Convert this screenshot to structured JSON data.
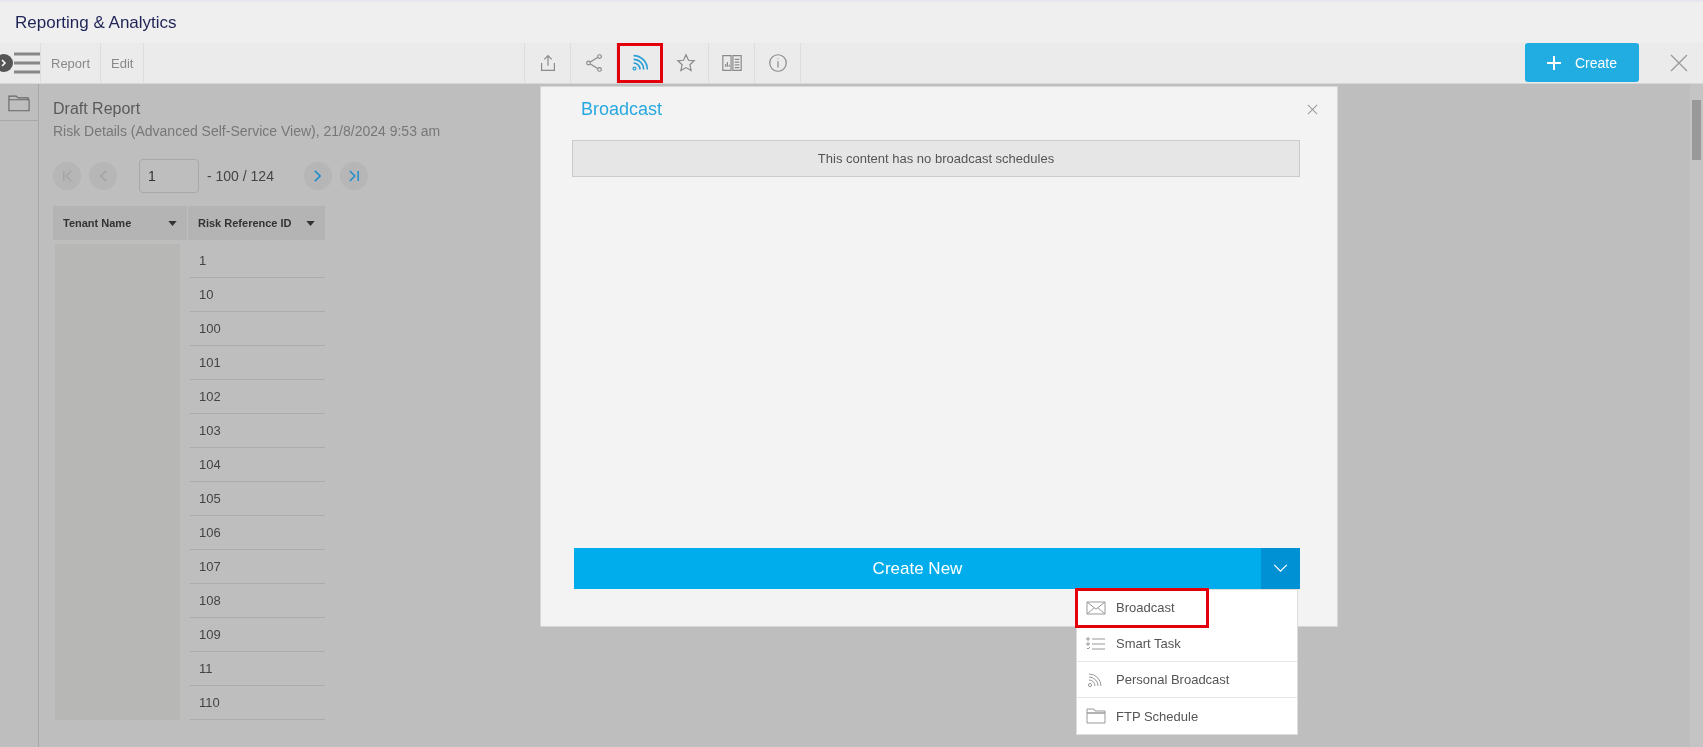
{
  "app_title": "Reporting & Analytics",
  "toolbar": {
    "tabs": [
      {
        "label": "Report"
      },
      {
        "label": "Edit"
      }
    ],
    "icons": [
      {
        "kind": "upload",
        "selected": false,
        "highlighted": false
      },
      {
        "kind": "share",
        "selected": false,
        "highlighted": false
      },
      {
        "kind": "rss",
        "selected": true,
        "highlighted": true
      },
      {
        "kind": "star",
        "selected": false,
        "highlighted": false
      },
      {
        "kind": "book",
        "selected": false,
        "highlighted": false
      },
      {
        "kind": "info",
        "selected": false,
        "highlighted": false
      }
    ],
    "create_button": "Create"
  },
  "report": {
    "title": "Draft Report",
    "subtitle": "Risk Details (Advanced Self-Service View), 21/8/2024 9:53 am",
    "pager": {
      "back": [
        {
          "kind": "first",
          "disabled": true
        },
        {
          "kind": "prev",
          "disabled": true
        }
      ],
      "page": "1",
      "range": "- 100 / 124",
      "forward": [
        {
          "kind": "next",
          "disabled": false
        },
        {
          "kind": "last",
          "disabled": false
        }
      ]
    },
    "table": {
      "columns": [
        "Tenant Name",
        "Risk Reference ID"
      ],
      "rows": [
        {
          "risk_reference_id": "1"
        },
        {
          "risk_reference_id": "10"
        },
        {
          "risk_reference_id": "100"
        },
        {
          "risk_reference_id": "101"
        },
        {
          "risk_reference_id": "102"
        },
        {
          "risk_reference_id": "103"
        },
        {
          "risk_reference_id": "104"
        },
        {
          "risk_reference_id": "105"
        },
        {
          "risk_reference_id": "106"
        },
        {
          "risk_reference_id": "107"
        },
        {
          "risk_reference_id": "108"
        },
        {
          "risk_reference_id": "109"
        },
        {
          "risk_reference_id": "11"
        },
        {
          "risk_reference_id": "110"
        }
      ]
    }
  },
  "dialog": {
    "title": "Broadcast",
    "message": "This content has no broadcast schedules",
    "create_button": "Create New",
    "menu": [
      {
        "kind": "mail",
        "label": "Broadcast",
        "highlighted": true
      },
      {
        "kind": "tasks",
        "label": "Smart Task",
        "highlighted": false
      },
      {
        "kind": "rss",
        "label": "Personal Broadcast",
        "highlighted": false
      },
      {
        "kind": "folder",
        "label": "FTP Schedule",
        "highlighted": false
      }
    ]
  }
}
